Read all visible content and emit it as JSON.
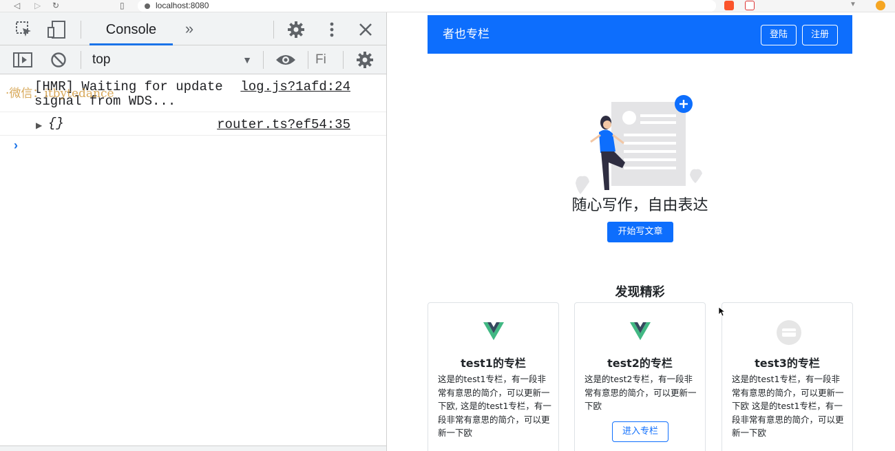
{
  "browser": {
    "url": "localhost:8080",
    "back_icon": "back-icon",
    "forward_icon": "forward-icon",
    "reload_icon": "reload-icon",
    "bookmark_icon": "bookmark-icon"
  },
  "devtools": {
    "tabs": {
      "console_label": "Console",
      "more_label": "»"
    },
    "toolbar": {
      "context": "top",
      "filter_placeholder": "Fi"
    },
    "console": {
      "lines": [
        {
          "message": "[HMR] Waiting for update signal from WDS...",
          "source": "log.js?1afd:24"
        },
        {
          "message": "{}",
          "source": "router.ts?ef54:35"
        }
      ],
      "watermark": "·微信：itbytedance",
      "prompt": "›"
    }
  },
  "page": {
    "navbar": {
      "brand": "者也专栏",
      "login": "登陆",
      "register": "注册",
      "color": "#0d6efd"
    },
    "hero": {
      "title": "随心写作，自由表达",
      "button": "开始写文章"
    },
    "section_title": "发现精彩",
    "cards": [
      {
        "title": "test1的专栏",
        "description": "这是的test1专栏，有一段非常有意思的简介，可以更新一下欧, 这是的test1专栏，有一段非常有意思的简介，可以更新一下欧",
        "logo": "vue-logo-icon"
      },
      {
        "title": "test2的专栏",
        "description": "这是的test2专栏，有一段非常有意思的简介，可以更新一下欧",
        "button": "进入专栏",
        "logo": "vue-logo-icon"
      },
      {
        "title": "test3的专栏",
        "description": "这是的test1专栏，有一段非常有意思的简介，可以更新一下欧 这是的test1专栏，有一段非常有意思的简介，可以更新一下欧",
        "logo": "placeholder-logo-icon"
      }
    ]
  }
}
